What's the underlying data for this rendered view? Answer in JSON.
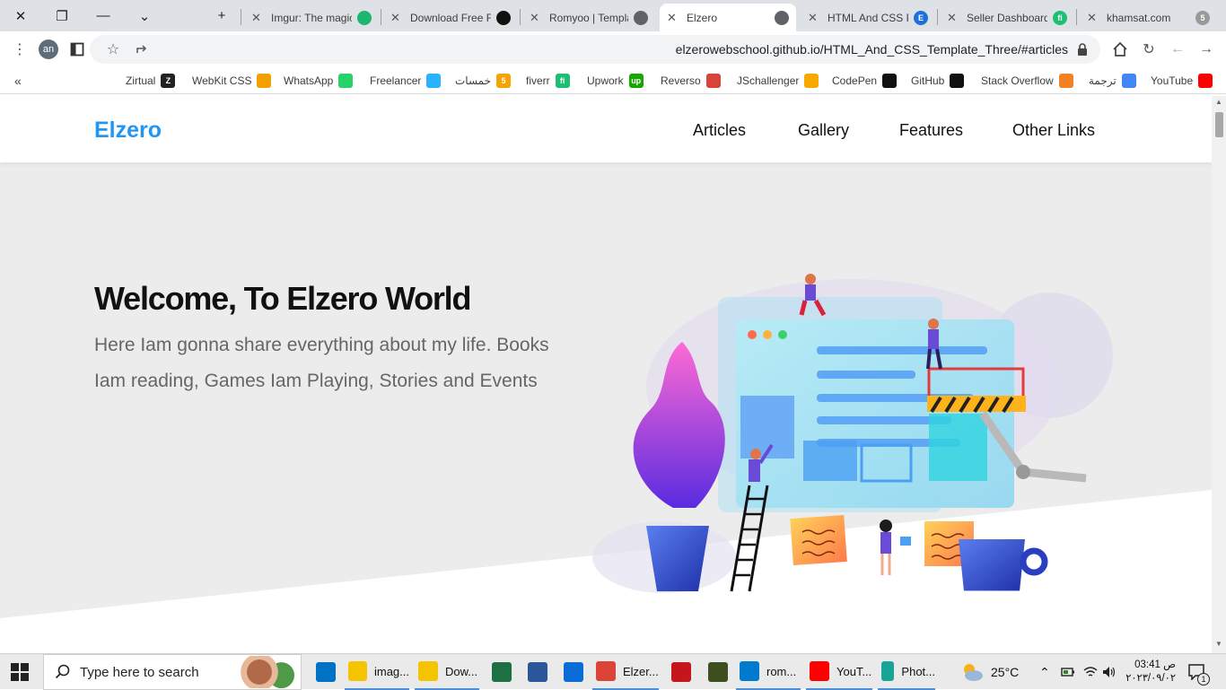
{
  "browser": {
    "tabs": [
      {
        "title": "Imgur: The magic",
        "favicon": "imgur-icon",
        "color": "#1bb76e"
      },
      {
        "title": "Download Free F",
        "favicon": "freepik-icon",
        "color": "#111111"
      },
      {
        "title": "Romyoo | Templa",
        "favicon": "globe-icon",
        "color": "#5f6368"
      },
      {
        "title": "Elzero",
        "favicon": "globe-icon",
        "color": "#5f6368",
        "active": true
      },
      {
        "title": "HTML And CSS P",
        "favicon": "elzero-e-icon",
        "color": "#1e6fd9"
      },
      {
        "title": "Seller Dashboard",
        "favicon": "fiverr-icon",
        "color": "#1dbf73"
      },
      {
        "title": "khamsat.com",
        "favicon": "khamsat-icon",
        "color": "#999999"
      }
    ],
    "tab_badges": {
      "imgur": "",
      "freepik": "",
      "elzero": "E",
      "fiverr": "fi",
      "khamsat": "5"
    },
    "profile_initials": "an",
    "url": "elzerowebschool.github.io/HTML_And_CSS_Template_Three/#articles",
    "bookmarks": [
      {
        "label": "Zirtual",
        "icon": "Z",
        "color": "#222222"
      },
      {
        "label": "WebKit CSS",
        "icon": "",
        "color": "#f0a000"
      },
      {
        "label": "WhatsApp",
        "icon": "",
        "color": "#25d366"
      },
      {
        "label": "Freelancer",
        "icon": "",
        "color": "#29b2fe"
      },
      {
        "label": "خمسات",
        "icon": "5",
        "color": "#f4a300"
      },
      {
        "label": "fiverr",
        "icon": "fi",
        "color": "#1dbf73"
      },
      {
        "label": "Upwork",
        "icon": "up",
        "color": "#14a800"
      },
      {
        "label": "Reverso",
        "icon": "",
        "color": "#d9443a"
      },
      {
        "label": "JSchallenger",
        "icon": "",
        "color": "#f7a900"
      },
      {
        "label": "CodePen",
        "icon": "",
        "color": "#111111"
      },
      {
        "label": "GitHub",
        "icon": "",
        "color": "#111111"
      },
      {
        "label": "Stack Overflow",
        "icon": "",
        "color": "#f48024"
      },
      {
        "label": "ترجمة",
        "icon": "",
        "color": "#4285f4"
      },
      {
        "label": "YouTube",
        "icon": "",
        "color": "#ff0000"
      }
    ]
  },
  "site": {
    "logo": "Elzero",
    "nav": [
      "Articles",
      "Gallery",
      "Features",
      "Other Links"
    ],
    "hero_title": "Welcome, To Elzero World",
    "hero_text": "Here Iam gonna share everything about my life. Books Iam reading, Games Iam Playing, Stories and Events",
    "colors": {
      "accent": "#2196f3",
      "landing_bg": "#ececec"
    }
  },
  "taskbar": {
    "search_placeholder": "Type here to search",
    "apps": [
      {
        "label": "",
        "icon": "mail-icon",
        "color": "#0072c6"
      },
      {
        "label": "imag...",
        "icon": "folder-icon",
        "color": "#f5c400"
      },
      {
        "label": "Dow...",
        "icon": "folder-icon",
        "color": "#f5c400"
      },
      {
        "label": "",
        "icon": "excel-icon",
        "color": "#1d7044"
      },
      {
        "label": "",
        "icon": "word-icon",
        "color": "#2b579a"
      },
      {
        "label": "",
        "icon": "photos-icon",
        "color": "#0a6cd6"
      },
      {
        "label": "Elzer...",
        "icon": "chrome-icon",
        "color": "#db4437"
      },
      {
        "label": "",
        "icon": "gear-app-icon",
        "color": "#c4161c"
      },
      {
        "label": "",
        "icon": "app-icon",
        "color": "#3d4f1f"
      },
      {
        "label": "rom...",
        "icon": "vscode-icon",
        "color": "#007acc"
      },
      {
        "label": "YouT...",
        "icon": "youtube-icon",
        "color": "#ff0000"
      },
      {
        "label": "Phot...",
        "icon": "photopea-icon",
        "color": "#18a497"
      }
    ],
    "temperature": "25°C",
    "time": "03:41 ص",
    "date": "٢٠٢٣/٠٩/٠٢",
    "notification_count": "1"
  }
}
